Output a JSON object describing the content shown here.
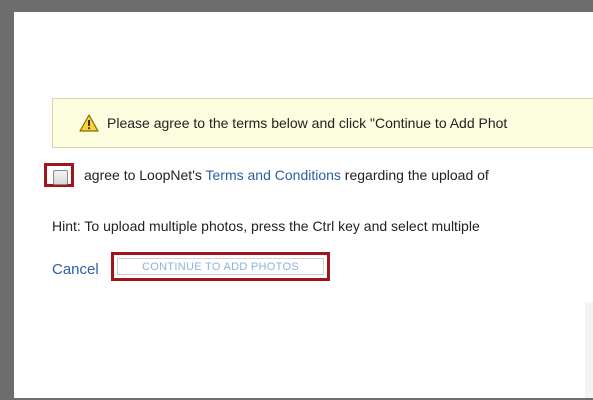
{
  "notice": {
    "icon": "warning-icon",
    "text": "Please agree to the terms below and click \"Continue to Add Phot"
  },
  "agreement": {
    "checked": false,
    "prefix": "agree to LoopNet's ",
    "link_text": "Terms and Conditions",
    "suffix": " regarding the upload of"
  },
  "hint": {
    "text": "Hint: To upload multiple photos, press the Ctrl key and select multiple"
  },
  "actions": {
    "cancel_label": "Cancel",
    "continue_label": "CONTINUE TO ADD PHOTOS"
  },
  "colors": {
    "highlight": "#a0141c",
    "link": "#2c5ea8",
    "notice_bg": "#fdfde0"
  }
}
